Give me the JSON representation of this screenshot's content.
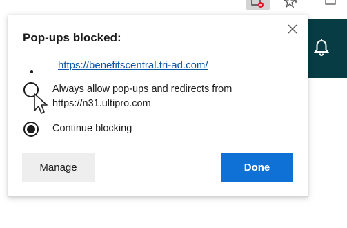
{
  "toolbar": {
    "icons": [
      "popup-blocked-icon",
      "favorites-star-icon",
      "edge-icon"
    ]
  },
  "popup": {
    "title": "Pop-ups blocked:",
    "close_icon": "close-icon",
    "blocked_url": "https://benefitscentral.tri-ad.com/",
    "options": [
      {
        "label": "Always allow pop-ups and redirects from https://n31.ultipro.com",
        "selected": false
      },
      {
        "label": "Continue blocking",
        "selected": true
      }
    ],
    "manage_label": "Manage",
    "done_label": "Done"
  },
  "app_header": {
    "icon": "bell-icon"
  },
  "colors": {
    "header_bg": "#073c44",
    "link": "#0b57a8",
    "done_bg": "#0f70d6",
    "manage_bg": "#efeeee",
    "blocked_badge": "#e81123"
  }
}
